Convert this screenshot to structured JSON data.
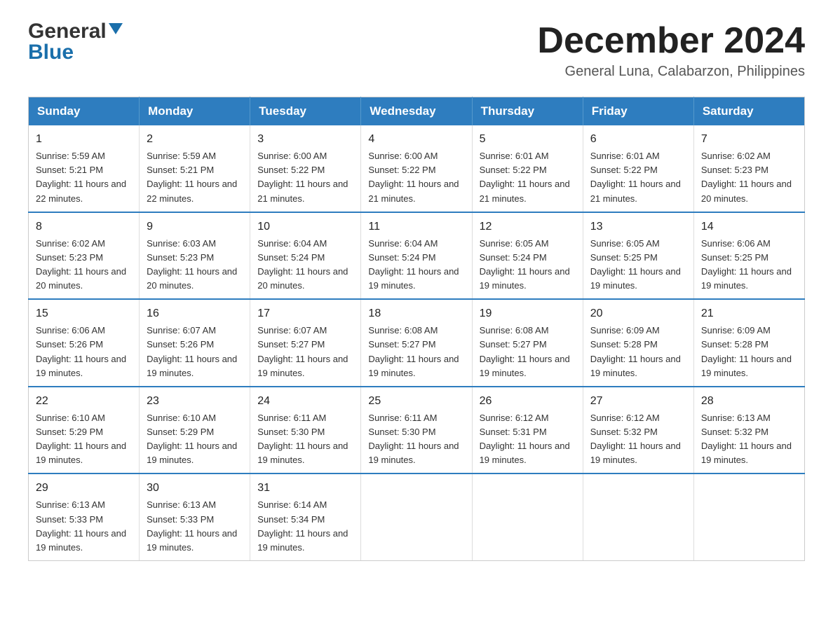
{
  "header": {
    "logo_general": "General",
    "logo_blue": "Blue",
    "month_title": "December 2024",
    "location": "General Luna, Calabarzon, Philippines"
  },
  "days_of_week": [
    "Sunday",
    "Monday",
    "Tuesday",
    "Wednesday",
    "Thursday",
    "Friday",
    "Saturday"
  ],
  "weeks": [
    [
      {
        "day": "1",
        "sunrise": "5:59 AM",
        "sunset": "5:21 PM",
        "daylight": "11 hours and 22 minutes."
      },
      {
        "day": "2",
        "sunrise": "5:59 AM",
        "sunset": "5:21 PM",
        "daylight": "11 hours and 22 minutes."
      },
      {
        "day": "3",
        "sunrise": "6:00 AM",
        "sunset": "5:22 PM",
        "daylight": "11 hours and 21 minutes."
      },
      {
        "day": "4",
        "sunrise": "6:00 AM",
        "sunset": "5:22 PM",
        "daylight": "11 hours and 21 minutes."
      },
      {
        "day": "5",
        "sunrise": "6:01 AM",
        "sunset": "5:22 PM",
        "daylight": "11 hours and 21 minutes."
      },
      {
        "day": "6",
        "sunrise": "6:01 AM",
        "sunset": "5:22 PM",
        "daylight": "11 hours and 21 minutes."
      },
      {
        "day": "7",
        "sunrise": "6:02 AM",
        "sunset": "5:23 PM",
        "daylight": "11 hours and 20 minutes."
      }
    ],
    [
      {
        "day": "8",
        "sunrise": "6:02 AM",
        "sunset": "5:23 PM",
        "daylight": "11 hours and 20 minutes."
      },
      {
        "day": "9",
        "sunrise": "6:03 AM",
        "sunset": "5:23 PM",
        "daylight": "11 hours and 20 minutes."
      },
      {
        "day": "10",
        "sunrise": "6:04 AM",
        "sunset": "5:24 PM",
        "daylight": "11 hours and 20 minutes."
      },
      {
        "day": "11",
        "sunrise": "6:04 AM",
        "sunset": "5:24 PM",
        "daylight": "11 hours and 19 minutes."
      },
      {
        "day": "12",
        "sunrise": "6:05 AM",
        "sunset": "5:24 PM",
        "daylight": "11 hours and 19 minutes."
      },
      {
        "day": "13",
        "sunrise": "6:05 AM",
        "sunset": "5:25 PM",
        "daylight": "11 hours and 19 minutes."
      },
      {
        "day": "14",
        "sunrise": "6:06 AM",
        "sunset": "5:25 PM",
        "daylight": "11 hours and 19 minutes."
      }
    ],
    [
      {
        "day": "15",
        "sunrise": "6:06 AM",
        "sunset": "5:26 PM",
        "daylight": "11 hours and 19 minutes."
      },
      {
        "day": "16",
        "sunrise": "6:07 AM",
        "sunset": "5:26 PM",
        "daylight": "11 hours and 19 minutes."
      },
      {
        "day": "17",
        "sunrise": "6:07 AM",
        "sunset": "5:27 PM",
        "daylight": "11 hours and 19 minutes."
      },
      {
        "day": "18",
        "sunrise": "6:08 AM",
        "sunset": "5:27 PM",
        "daylight": "11 hours and 19 minutes."
      },
      {
        "day": "19",
        "sunrise": "6:08 AM",
        "sunset": "5:27 PM",
        "daylight": "11 hours and 19 minutes."
      },
      {
        "day": "20",
        "sunrise": "6:09 AM",
        "sunset": "5:28 PM",
        "daylight": "11 hours and 19 minutes."
      },
      {
        "day": "21",
        "sunrise": "6:09 AM",
        "sunset": "5:28 PM",
        "daylight": "11 hours and 19 minutes."
      }
    ],
    [
      {
        "day": "22",
        "sunrise": "6:10 AM",
        "sunset": "5:29 PM",
        "daylight": "11 hours and 19 minutes."
      },
      {
        "day": "23",
        "sunrise": "6:10 AM",
        "sunset": "5:29 PM",
        "daylight": "11 hours and 19 minutes."
      },
      {
        "day": "24",
        "sunrise": "6:11 AM",
        "sunset": "5:30 PM",
        "daylight": "11 hours and 19 minutes."
      },
      {
        "day": "25",
        "sunrise": "6:11 AM",
        "sunset": "5:30 PM",
        "daylight": "11 hours and 19 minutes."
      },
      {
        "day": "26",
        "sunrise": "6:12 AM",
        "sunset": "5:31 PM",
        "daylight": "11 hours and 19 minutes."
      },
      {
        "day": "27",
        "sunrise": "6:12 AM",
        "sunset": "5:32 PM",
        "daylight": "11 hours and 19 minutes."
      },
      {
        "day": "28",
        "sunrise": "6:13 AM",
        "sunset": "5:32 PM",
        "daylight": "11 hours and 19 minutes."
      }
    ],
    [
      {
        "day": "29",
        "sunrise": "6:13 AM",
        "sunset": "5:33 PM",
        "daylight": "11 hours and 19 minutes."
      },
      {
        "day": "30",
        "sunrise": "6:13 AM",
        "sunset": "5:33 PM",
        "daylight": "11 hours and 19 minutes."
      },
      {
        "day": "31",
        "sunrise": "6:14 AM",
        "sunset": "5:34 PM",
        "daylight": "11 hours and 19 minutes."
      },
      null,
      null,
      null,
      null
    ]
  ],
  "labels": {
    "sunrise_prefix": "Sunrise: ",
    "sunset_prefix": "Sunset: ",
    "daylight_prefix": "Daylight: "
  }
}
